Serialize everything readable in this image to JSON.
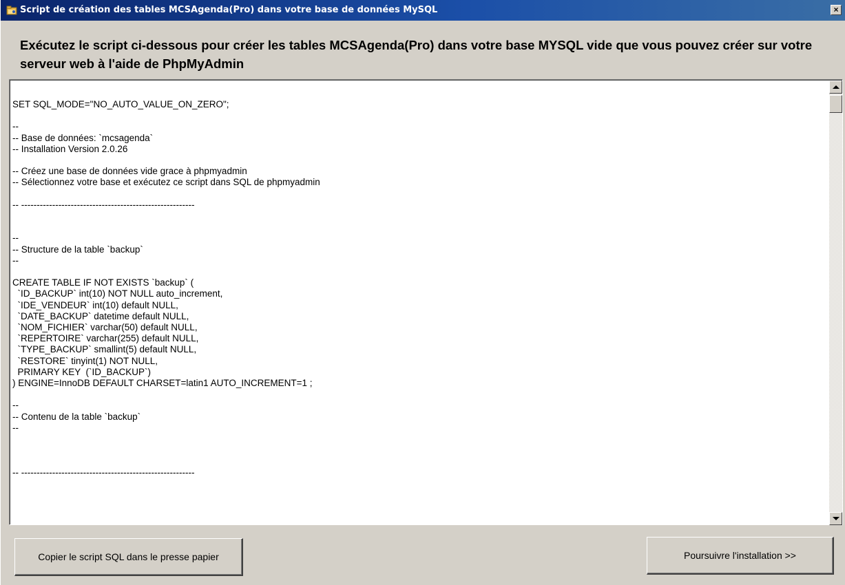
{
  "window": {
    "title": "Script de création des tables MCSAgenda(Pro) dans votre base de données MySQL",
    "close_label": "×",
    "app_icon": "folder-icon"
  },
  "instructions": "Exécutez le script ci-dessous pour créer les tables MCSAgenda(Pro) dans votre base MYSQL vide que vous pouvez créer sur votre serveur web à l'aide de PhpMyAdmin",
  "editor": {
    "content": "SET SQL_MODE=\"NO_AUTO_VALUE_ON_ZERO\";\n\n--\n-- Base de données: `mcsagenda`\n-- Installation Version 2.0.26\n\n-- Créez une base de données vide grace à phpmyadmin\n-- Sélectionnez votre base et exécutez ce script dans SQL de phpmyadmin\n\n-- --------------------------------------------------------\n\n\n--\n-- Structure de la table `backup`\n--\n\nCREATE TABLE IF NOT EXISTS `backup` (\n  `ID_BACKUP` int(10) NOT NULL auto_increment,\n  `IDE_VENDEUR` int(10) default NULL,\n  `DATE_BACKUP` datetime default NULL,\n  `NOM_FICHIER` varchar(50) default NULL,\n  `REPERTOIRE` varchar(255) default NULL,\n  `TYPE_BACKUP` smallint(5) default NULL,\n  `RESTORE` tinyint(1) NOT NULL,\n  PRIMARY KEY  (`ID_BACKUP`)\n) ENGINE=InnoDB DEFAULT CHARSET=latin1 AUTO_INCREMENT=1 ;\n\n--\n-- Contenu de la table `backup`\n--\n\n\n\n-- --------------------------------------------------------"
  },
  "buttons": {
    "copy_label": "Copier le script SQL dans le presse papier",
    "continue_label": "Poursuivre l'installation >>"
  }
}
